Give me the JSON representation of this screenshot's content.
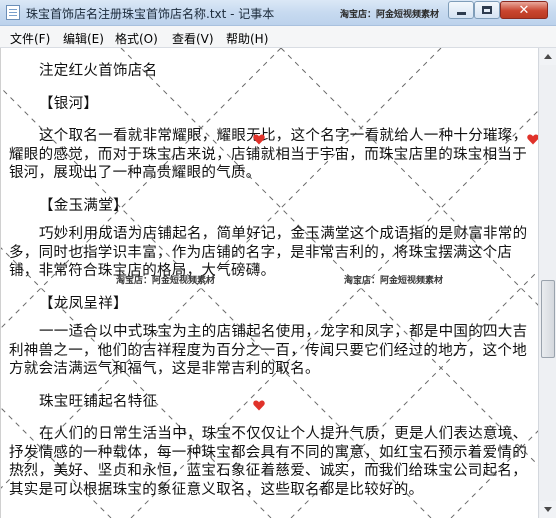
{
  "window": {
    "title": "珠宝首饰店名注册珠宝首饰店名称.txt - 记事本",
    "title_overlay": "淘宝店：阿金短视频素材"
  },
  "menu": {
    "items": [
      {
        "label": "文件(F)"
      },
      {
        "label": "编辑(E)"
      },
      {
        "label": "格式(O)"
      },
      {
        "label": "查看(V)"
      },
      {
        "label": "帮助(H)"
      }
    ]
  },
  "document": {
    "heading": "注定红火首饰店名",
    "sections": [
      {
        "title": "【银河】",
        "body": "这个取名一看就非常耀眼，耀眼无比，这个名字一看就给人一种十分璀璨，耀眼的感觉，而对于珠宝店来说，店铺就相当于宇宙，而珠宝店里的珠宝相当于银河，展现出了一种高贵耀眼的气质。"
      },
      {
        "title": "【金玉满堂】",
        "body": "巧妙利用成语为店铺起名，简单好记，金玉满堂这个成语指的是财富非常的多，同时也指学识丰富，作为店铺的名字，是非常吉利的，将珠宝摆满这个店铺，非常符合珠宝店的格局，大气磅礴。"
      },
      {
        "title": "【龙凤呈祥】",
        "body": "一一适合以中式珠宝为主的店铺起名使用，龙字和凤字，都是中国的四大吉利神兽之一，他们的吉祥程度为百分之一百，传闻只要它们经过的地方，这个地方就会洁满运气和福气，这是非常吉利的取名。"
      }
    ],
    "subheading": "珠宝旺铺起名特征",
    "closing": "在人们的日常生活当中，珠宝不仅仅让个人提升气质，更是人们表达意境、抒发情感的一种载体，每一种珠宝都会具有不同的寓意，如红宝石预示着爱情的热烈，美好、坚贞和永恒，蓝宝石象征着慈爱、诚实，而我们给珠宝公司起名，其实是可以根据珠宝的象征意义取名，这些取名都是比较好的。"
  },
  "watermark": {
    "text": "淘宝店：阿金短视频素材"
  },
  "scrollbar": {
    "position_fraction": 0.6
  }
}
